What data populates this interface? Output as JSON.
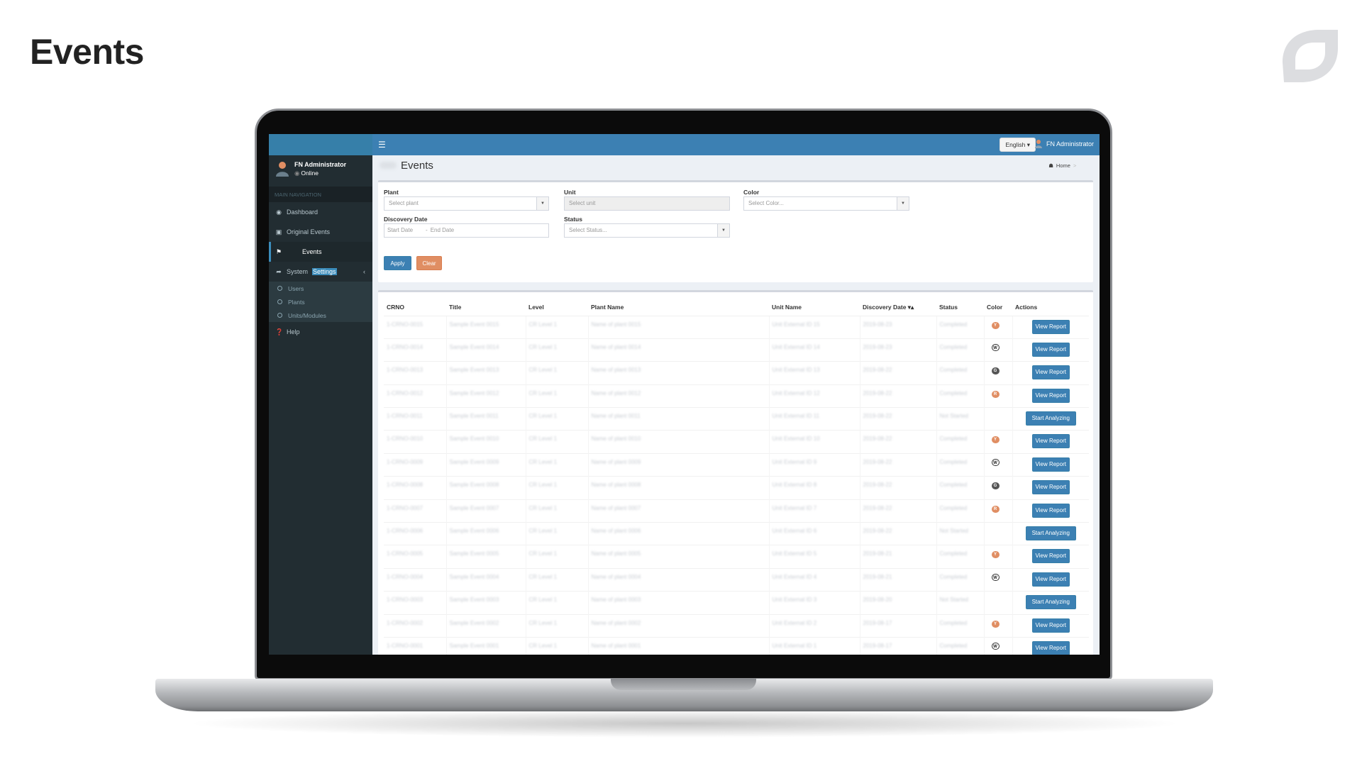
{
  "page": {
    "title": "Events"
  },
  "colors": {
    "topbar": "#3c80b3",
    "sidebar": "#222d32",
    "accent": "#3c8dbc",
    "clear": "#e08e63",
    "yellow_badge": "#e08e63",
    "red_badge": "#e08e63",
    "gray_badge": "#555555"
  },
  "topbar": {
    "menu_icon": "hamburger-icon",
    "language": "English",
    "user": "FN Administrator"
  },
  "sidebar": {
    "user_name": "FN Administrator",
    "user_status": "Online",
    "nav_header": "MAIN NAVIGATION",
    "items": [
      {
        "label": "Dashboard",
        "icon": "dashboard-icon"
      },
      {
        "label": "Original Events",
        "icon": "inbox-icon"
      },
      {
        "label": "Events",
        "icon": "flag-icon",
        "active": true
      },
      {
        "label_pre": "System",
        "label_hl": "Settings",
        "icon": "share-icon"
      },
      {
        "label": "Help",
        "icon": "question-circle-icon"
      }
    ],
    "sub_items": [
      "Users",
      "Plants",
      "Units/Modules"
    ]
  },
  "content": {
    "title": "Events",
    "breadcrumb_home": "Home"
  },
  "filters": {
    "plant_label": "Plant",
    "plant_placeholder": "Select plant",
    "unit_label": "Unit",
    "unit_placeholder": "Select unit",
    "color_label": "Color",
    "color_placeholder": "Select Color...",
    "date_label": "Discovery Date",
    "start_placeholder": "Start Date",
    "end_placeholder": "End Date",
    "status_label": "Status",
    "status_placeholder": "Select Status...",
    "apply": "Apply",
    "clear": "Clear"
  },
  "table": {
    "columns": [
      "CRNO",
      "Title",
      "Level",
      "Plant Name",
      "Unit Name",
      "Discovery Date ▾▴",
      "Status",
      "Color",
      "Actions"
    ],
    "rows": [
      {
        "crno": "1-CRNO-0015",
        "title": "Sample Event 0015",
        "level": "CR Level 1",
        "plant": "Name of plant 0015",
        "unit": "Unit External ID 15",
        "date": "2019-08-23",
        "status": "Completed",
        "color": "Y",
        "action": "View Report"
      },
      {
        "crno": "1-CRNO-0014",
        "title": "Sample Event 0014",
        "level": "CR Level 1",
        "plant": "Name of plant 0014",
        "unit": "Unit External ID 14",
        "date": "2019-08-23",
        "status": "Completed",
        "color": "W",
        "action": "View Report"
      },
      {
        "crno": "1-CRNO-0013",
        "title": "Sample Event 0013",
        "level": "CR Level 1",
        "plant": "Name of plant 0013",
        "unit": "Unit External ID 13",
        "date": "2019-08-22",
        "status": "Completed",
        "color": "G",
        "action": "View Report"
      },
      {
        "crno": "1-CRNO-0012",
        "title": "Sample Event 0012",
        "level": "CR Level 1",
        "plant": "Name of plant 0012",
        "unit": "Unit External ID 12",
        "date": "2019-08-22",
        "status": "Completed",
        "color": "R",
        "action": "View Report"
      },
      {
        "crno": "1-CRNO-0011",
        "title": "Sample Event 0011",
        "level": "CR Level 1",
        "plant": "Name of plant 0011",
        "unit": "Unit External ID 11",
        "date": "2019-08-22",
        "status": "Not Started",
        "color": "",
        "action": "Start Analyzing"
      },
      {
        "crno": "1-CRNO-0010",
        "title": "Sample Event 0010",
        "level": "CR Level 1",
        "plant": "Name of plant 0010",
        "unit": "Unit External ID 10",
        "date": "2019-08-22",
        "status": "Completed",
        "color": "Y",
        "action": "View Report"
      },
      {
        "crno": "1-CRNO-0009",
        "title": "Sample Event 0009",
        "level": "CR Level 1",
        "plant": "Name of plant 0009",
        "unit": "Unit External ID 9",
        "date": "2019-08-22",
        "status": "Completed",
        "color": "W",
        "action": "View Report"
      },
      {
        "crno": "1-CRNO-0008",
        "title": "Sample Event 0008",
        "level": "CR Level 1",
        "plant": "Name of plant 0008",
        "unit": "Unit External ID 8",
        "date": "2019-08-22",
        "status": "Completed",
        "color": "G",
        "action": "View Report"
      },
      {
        "crno": "1-CRNO-0007",
        "title": "Sample Event 0007",
        "level": "CR Level 1",
        "plant": "Name of plant 0007",
        "unit": "Unit External ID 7",
        "date": "2019-08-22",
        "status": "Completed",
        "color": "R",
        "action": "View Report"
      },
      {
        "crno": "1-CRNO-0006",
        "title": "Sample Event 0006",
        "level": "CR Level 1",
        "plant": "Name of plant 0006",
        "unit": "Unit External ID 6",
        "date": "2019-08-22",
        "status": "Not Started",
        "color": "",
        "action": "Start Analyzing"
      },
      {
        "crno": "1-CRNO-0005",
        "title": "Sample Event 0005",
        "level": "CR Level 1",
        "plant": "Name of plant 0005",
        "unit": "Unit External ID 5",
        "date": "2019-08-21",
        "status": "Completed",
        "color": "Y",
        "action": "View Report"
      },
      {
        "crno": "1-CRNO-0004",
        "title": "Sample Event 0004",
        "level": "CR Level 1",
        "plant": "Name of plant 0004",
        "unit": "Unit External ID 4",
        "date": "2019-08-21",
        "status": "Completed",
        "color": "W",
        "action": "View Report"
      },
      {
        "crno": "1-CRNO-0003",
        "title": "Sample Event 0003",
        "level": "CR Level 1",
        "plant": "Name of plant 0003",
        "unit": "Unit External ID 3",
        "date": "2019-08-20",
        "status": "Not Started",
        "color": "",
        "action": "Start Analyzing"
      },
      {
        "crno": "1-CRNO-0002",
        "title": "Sample Event 0002",
        "level": "CR Level 1",
        "plant": "Name of plant 0002",
        "unit": "Unit External ID 2",
        "date": "2019-08-17",
        "status": "Completed",
        "color": "Y",
        "action": "View Report"
      },
      {
        "crno": "1-CRNO-0001",
        "title": "Sample Event 0001",
        "level": "CR Level 1",
        "plant": "Name of plant 0001",
        "unit": "Unit External ID 1",
        "date": "2019-08-17",
        "status": "Completed",
        "color": "W",
        "action": "View Report"
      }
    ]
  }
}
